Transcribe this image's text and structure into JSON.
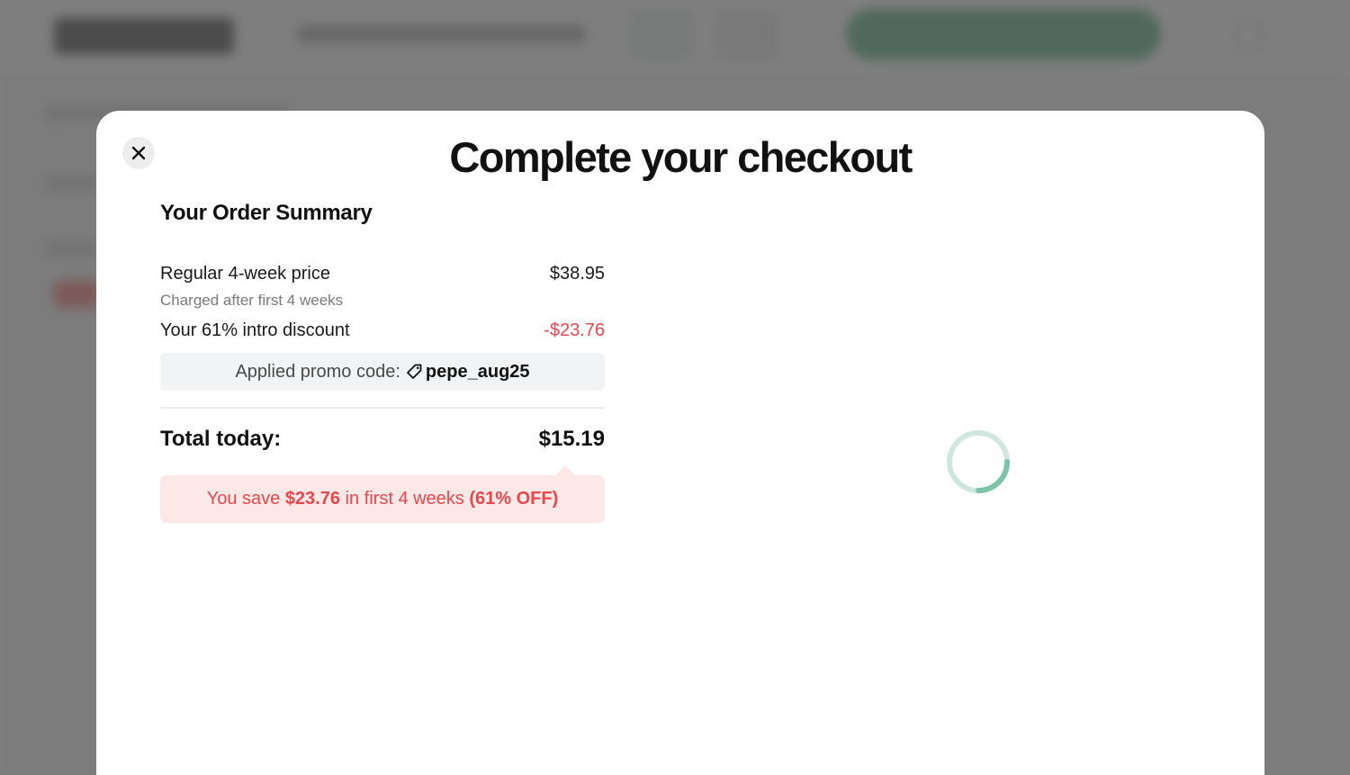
{
  "modal": {
    "title": "Complete your checkout"
  },
  "close_button": {
    "icon": "close-icon"
  },
  "order_summary": {
    "heading": "Your Order Summary",
    "regular_label": "Regular 4-week price",
    "regular_price": "$38.95",
    "regular_note": "Charged after first 4 weeks",
    "discount_label": "Your 61% intro discount",
    "discount_value": "-$23.76",
    "promo_label": "Applied promo code:",
    "promo_icon": "tag-icon",
    "promo_code": "pepe_aug25",
    "total_label": "Total today:",
    "total_value": "$15.19",
    "savings": {
      "prefix": "You save ",
      "amount": "$23.76",
      "middle": " in first 4 weeks ",
      "percent": "(61% OFF)"
    }
  },
  "loading": {
    "icon": "loading-spinner-icon"
  },
  "colors": {
    "discount_red": "#e5484d",
    "savings_bg": "#fde8e8",
    "spinner": "#7cc4a8"
  }
}
